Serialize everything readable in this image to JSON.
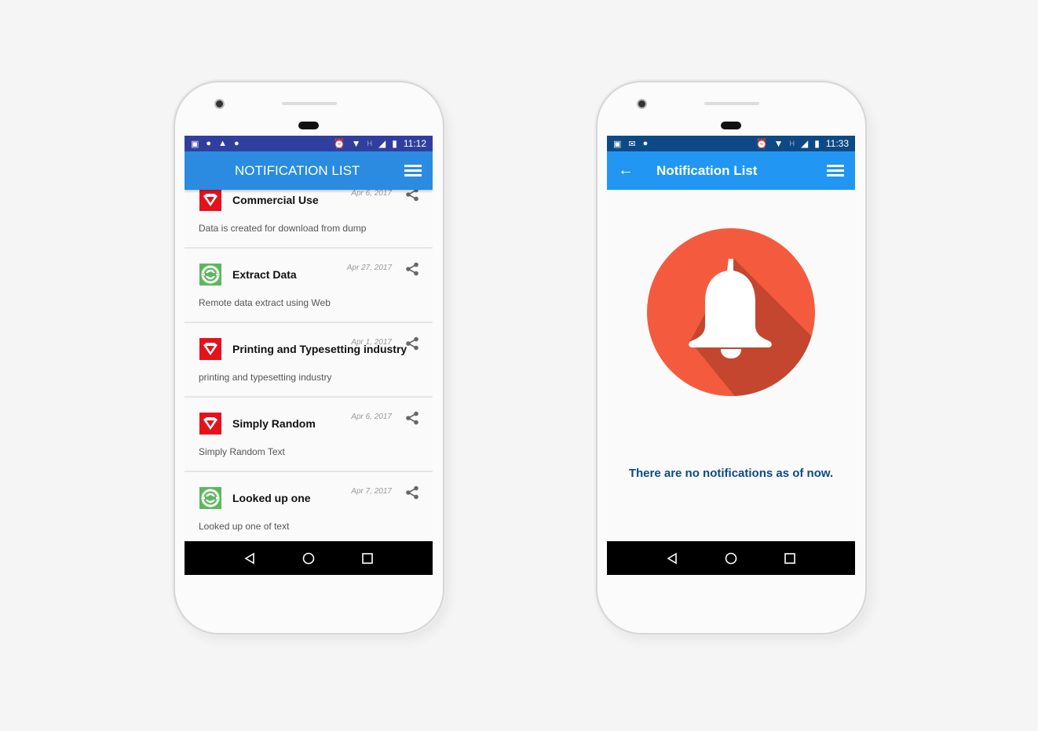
{
  "phone_left": {
    "status": {
      "time": "11:12",
      "network": "H"
    },
    "appbar": {
      "title": "NOTIFICATION LIST",
      "color": "#2a8be0"
    },
    "notifications": [
      {
        "title": "Commercial Use",
        "date": "Apr 6, 2017",
        "description": "Data is created for download from dump",
        "icon": "superman-icon"
      },
      {
        "title": "Extract Data",
        "date": "Apr 27, 2017",
        "description": "Remote data extract using Web",
        "icon": "green-lantern-icon"
      },
      {
        "title": "Printing and Typesetting industry",
        "date": "Apr 1, 2017",
        "description": "printing and typesetting industry",
        "icon": "superman-icon"
      },
      {
        "title": "Simply Random",
        "date": "Apr 6, 2017",
        "description": "Simply Random Text",
        "icon": "superman-icon"
      },
      {
        "title": "Looked up one",
        "date": "Apr 7, 2017",
        "description": "Looked up one of text",
        "icon": "green-lantern-icon"
      }
    ]
  },
  "phone_right": {
    "status": {
      "time": "11:33",
      "network": "H"
    },
    "appbar": {
      "title": "Notification List",
      "color": "#2196f3"
    },
    "empty_message": "There are no notifications as of now.",
    "bell_color": "#f45b3e"
  }
}
